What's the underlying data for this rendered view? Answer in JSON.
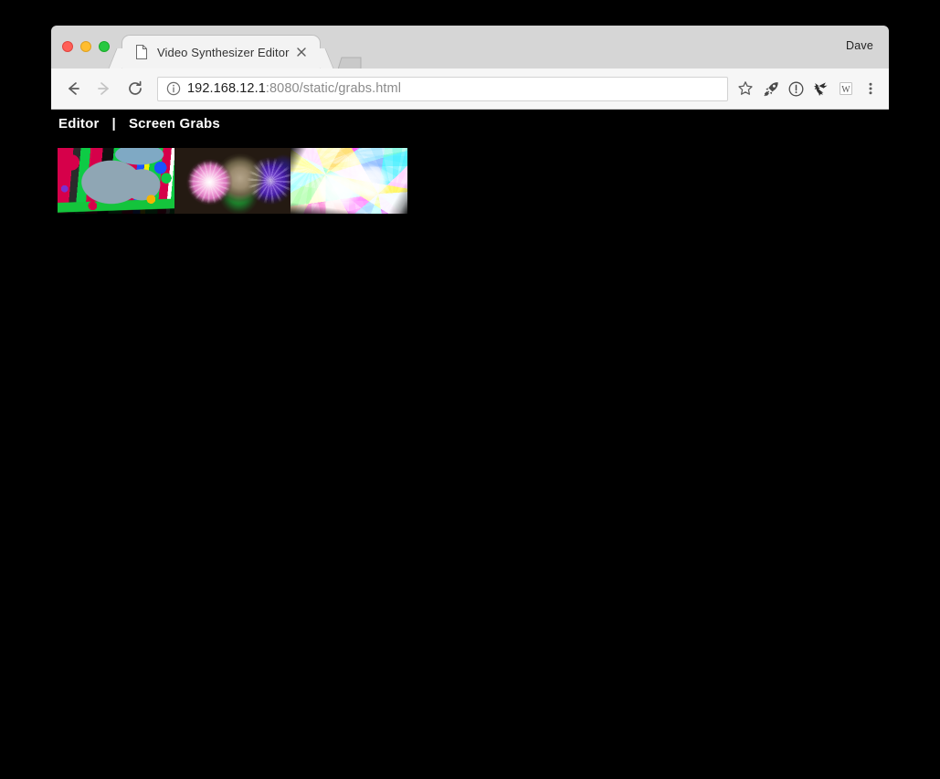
{
  "window": {
    "traffic_lights": [
      "close",
      "minimize",
      "maximize"
    ],
    "profile_name": "Dave"
  },
  "tab": {
    "title": "Video Synthesizer Editor",
    "favicon": "document-icon",
    "close_label": "×",
    "new_tab_label": "+"
  },
  "toolbar": {
    "back_label": "←",
    "forward_label": "→",
    "reload_label": "⟳",
    "site_info_icon": "info-circle-icon",
    "url_host": "192.168.12.1",
    "url_rest": ":8080/static/grabs.html",
    "url_full": "192.168.12.1:8080/static/grabs.html",
    "bookmark_icon": "star-icon",
    "extensions": [
      {
        "name": "rocket-extension-icon",
        "label": "rocket"
      },
      {
        "name": "info-extension-icon",
        "label": "info"
      },
      {
        "name": "bird-extension-icon",
        "label": "bird"
      },
      {
        "name": "wikipedia-extension-icon",
        "label": "W"
      }
    ],
    "menu_icon": "three-dot-menu-icon"
  },
  "page": {
    "nav": {
      "editor_label": "Editor",
      "separator": "|",
      "screen_grabs_label": "Screen Grabs"
    },
    "grabs": [
      {
        "id": "grab-1",
        "alt": "Screen grab 1 - posterized color field with gray blob",
        "theme": "thumb1"
      },
      {
        "id": "grab-2",
        "alt": "Screen grab 2 - radial bursts on dark background",
        "theme": "thumb2"
      },
      {
        "id": "grab-3",
        "alt": "Screen grab 3 - prismatic triangle shards",
        "theme": "thumb3"
      }
    ]
  },
  "colors": {
    "page_background": "#000000",
    "page_text": "#ffffff",
    "chrome_tabstrip": "#d6d6d6",
    "chrome_toolbar": "#f6f6f6",
    "url_host_text": "#202020",
    "url_rest_text": "#8b8b8b",
    "traffic_red": "#ff5f57",
    "traffic_yellow": "#ffbd2e",
    "traffic_green": "#28c840"
  }
}
